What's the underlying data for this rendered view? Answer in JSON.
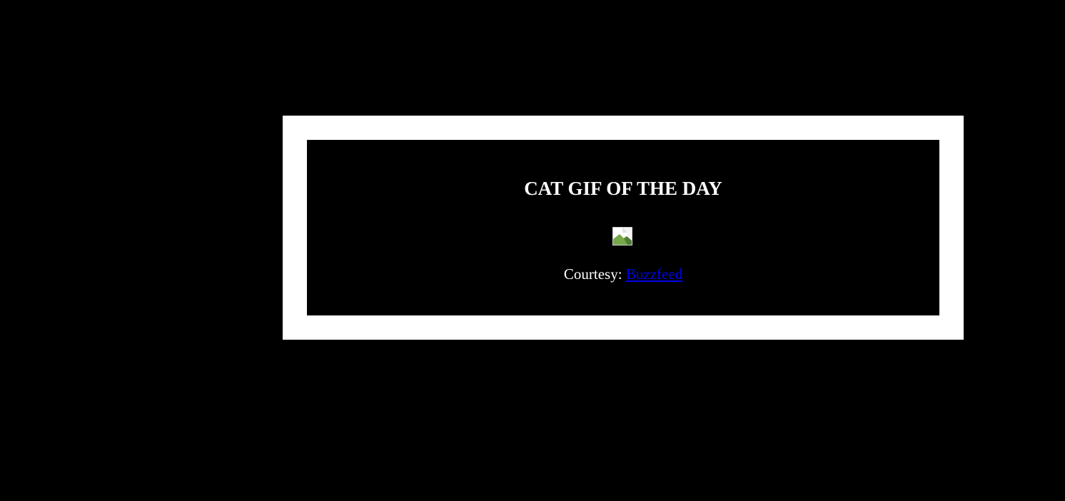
{
  "header": {
    "title": "CAT GIF OF THE DAY"
  },
  "image": {
    "icon": "broken-image-icon"
  },
  "credit": {
    "prefix": "Courtesy:",
    "link_label": "Buzzfeed"
  },
  "colors": {
    "background": "#000000",
    "frame": "#ffffff",
    "text": "#ffffff",
    "link": "#0000ee"
  }
}
